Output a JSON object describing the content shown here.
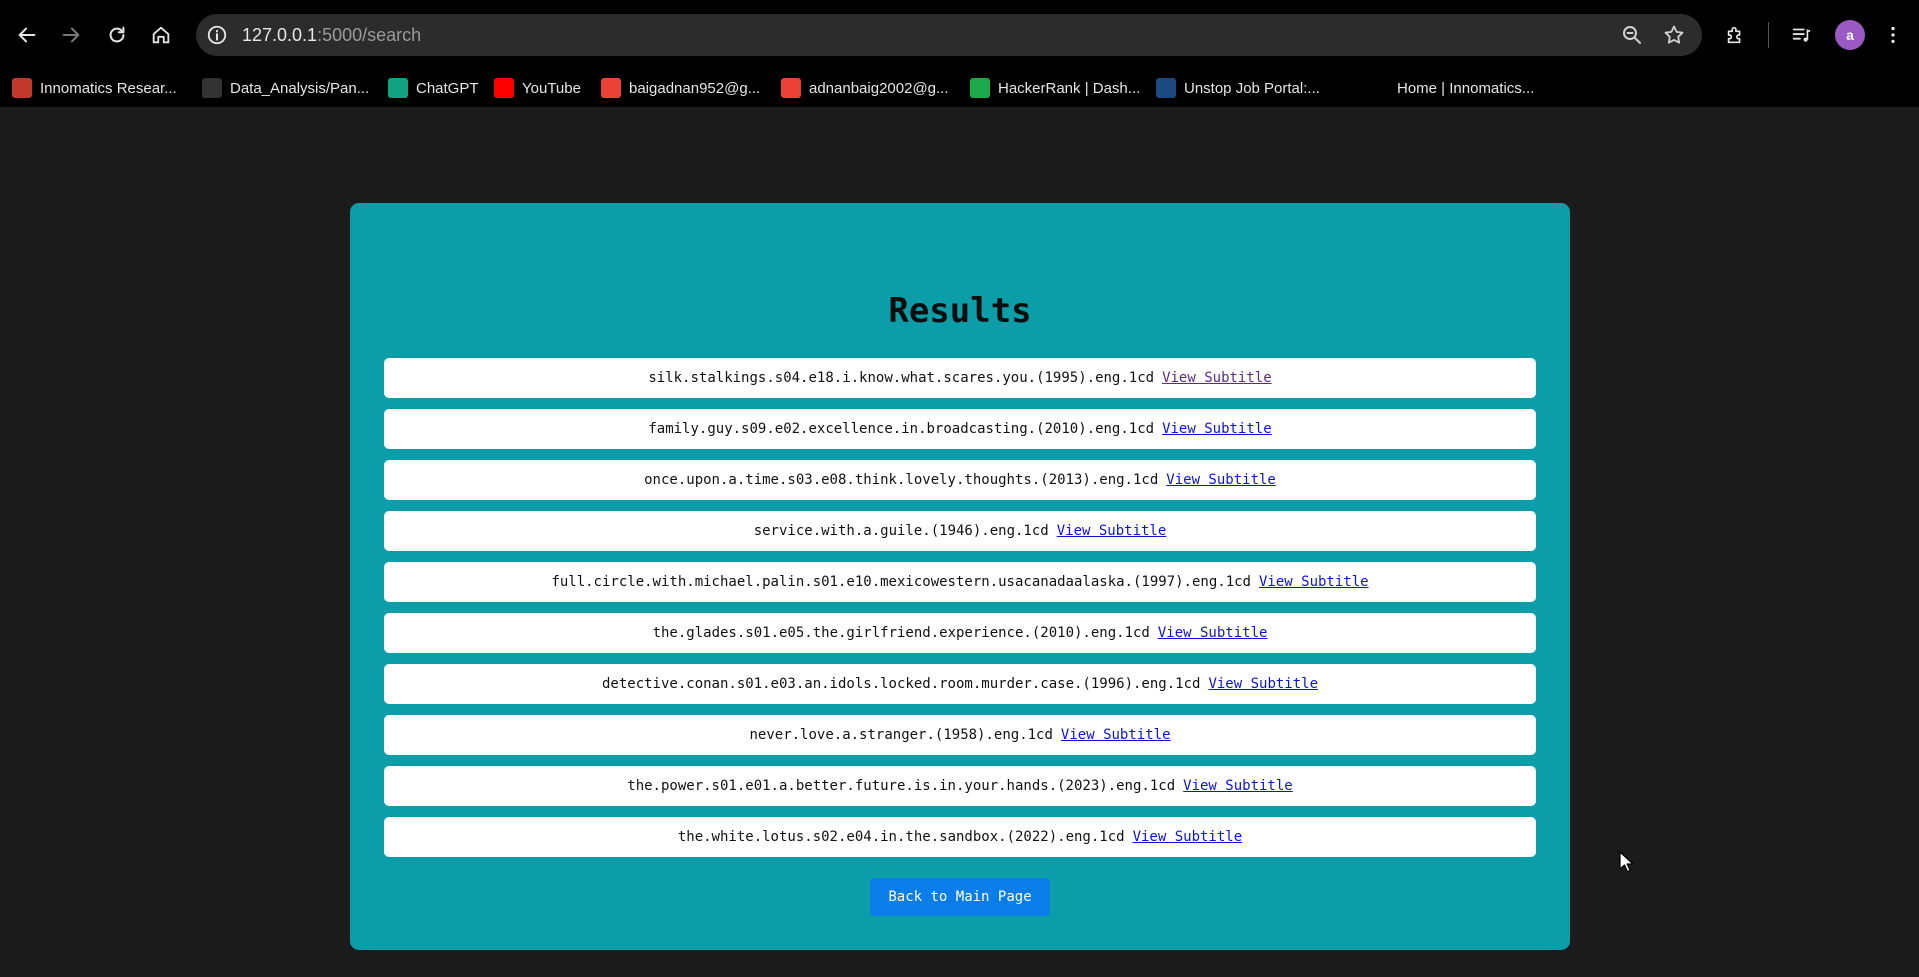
{
  "browser": {
    "url_host": "127.0.0.1",
    "url_path": ":5000/search",
    "avatar_letter": "a"
  },
  "bookmarks": [
    {
      "label": "Innomatics Resear...",
      "icon": "innomatics-icon",
      "color": "#c0392b"
    },
    {
      "label": "Data_Analysis/Pan...",
      "icon": "github-icon",
      "color": "#333333"
    },
    {
      "label": "ChatGPT",
      "icon": "chatgpt-icon",
      "color": "#10a37f"
    },
    {
      "label": "YouTube",
      "icon": "youtube-icon",
      "color": "#ff0000"
    },
    {
      "label": "baigadnan952@g...",
      "icon": "gmail-icon",
      "color": "#ea4335"
    },
    {
      "label": "adnanbaig2002@g...",
      "icon": "gmail-icon",
      "color": "#ea4335"
    },
    {
      "label": "HackerRank | Dash...",
      "icon": "hackerrank-icon",
      "color": "#1ba94c"
    },
    {
      "label": "Unstop Job Portal:...",
      "icon": "unstop-icon",
      "color": "#1c4980"
    },
    {
      "label": "Home | Innomatics...",
      "icon": "innomatics-home-icon",
      "color": "#000000"
    }
  ],
  "page": {
    "title": "Results",
    "link_label": "View Subtitle",
    "back_button": "Back to Main Page",
    "results": [
      {
        "name": "silk.stalkings.s04.e18.i.know.what.scares.you.(1995).eng.1cd",
        "visited": true
      },
      {
        "name": "family.guy.s09.e02.excellence.in.broadcasting.(2010).eng.1cd",
        "visited": false
      },
      {
        "name": "once.upon.a.time.s03.e08.think.lovely.thoughts.(2013).eng.1cd",
        "visited": false
      },
      {
        "name": "service.with.a.guile.(1946).eng.1cd",
        "visited": false
      },
      {
        "name": "full.circle.with.michael.palin.s01.e10.mexicowestern.usacanadaalaska.(1997).eng.1cd",
        "visited": false
      },
      {
        "name": "the.glades.s01.e05.the.girlfriend.experience.(2010).eng.1cd",
        "visited": false
      },
      {
        "name": "detective.conan.s01.e03.an.idols.locked.room.murder.case.(1996).eng.1cd",
        "visited": false
      },
      {
        "name": "never.love.a.stranger.(1958).eng.1cd",
        "visited": false
      },
      {
        "name": "the.power.s01.e01.a.better.future.is.in.your.hands.(2023).eng.1cd",
        "visited": false
      },
      {
        "name": "the.white.lotus.s02.e04.in.the.sandbox.(2022).eng.1cd",
        "visited": false
      }
    ]
  }
}
